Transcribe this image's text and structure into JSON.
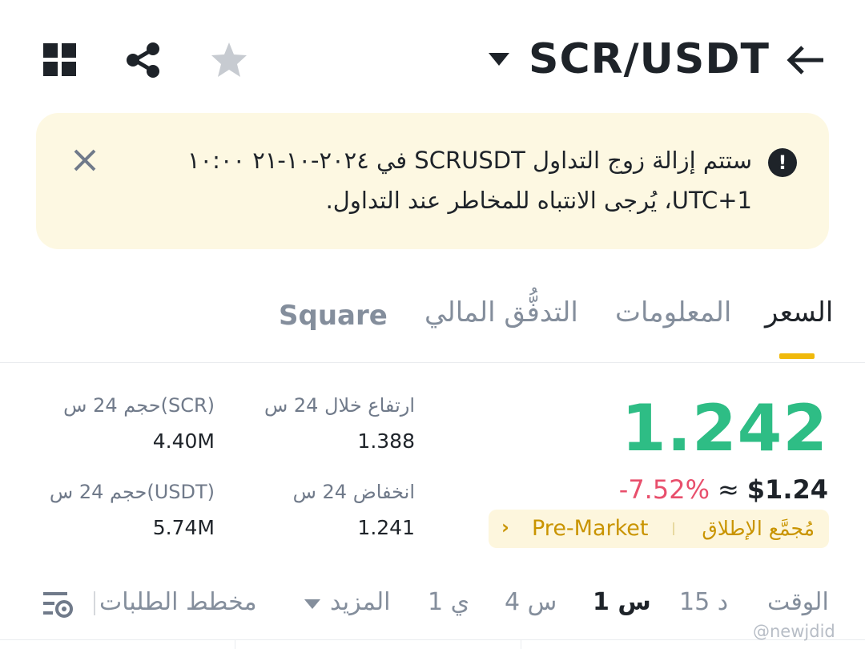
{
  "header": {
    "pair": "SCR/USDT",
    "icons": [
      "back-arrow-icon",
      "dropdown-caret-icon",
      "star-icon",
      "share-icon",
      "grid-icon"
    ]
  },
  "banner": {
    "line1": "ستتم إزالة زوج التداول SCRUSDT في ٢٠٢٤-١٠-٢١ ١٠:٠٠",
    "line2": "UTC+1، يُرجى الانتباه للمخاطر عند التداول."
  },
  "tabs": [
    {
      "label": "السعر",
      "active": true
    },
    {
      "label": "المعلومات",
      "active": false
    },
    {
      "label": "التدفُّق المالي",
      "active": false
    },
    {
      "label": "Square",
      "active": false
    }
  ],
  "market": {
    "price": "1.242",
    "usd_price": "$1.24",
    "approx": "≈",
    "change_pct": "-7.52%",
    "premarket_label": "Pre-Market",
    "launch_label": "مُجمَّع الإطلاق",
    "high_label": "ارتفاع خلال 24 س",
    "high_value": "1.388",
    "low_label": "انخفاض 24 س",
    "low_value": "1.241",
    "vol_base_label": "حجم 24 س(SCR)",
    "vol_base_value": "4.40M",
    "vol_quote_label": "حجم 24 س(USDT)",
    "vol_quote_value": "5.74M"
  },
  "timeframes": {
    "time_label": "الوقت",
    "options": [
      "15 د",
      "1 س",
      "4 س",
      "1 ي"
    ],
    "active": "1 س",
    "more_label": "المزيد",
    "depth_label": "مخطط الطلبات"
  },
  "watermark": "@newjdid",
  "colors": {
    "up": "#2ebd85",
    "down": "#e84f6c",
    "accent": "#f0b90b",
    "banner_bg": "#fdf8e2"
  }
}
